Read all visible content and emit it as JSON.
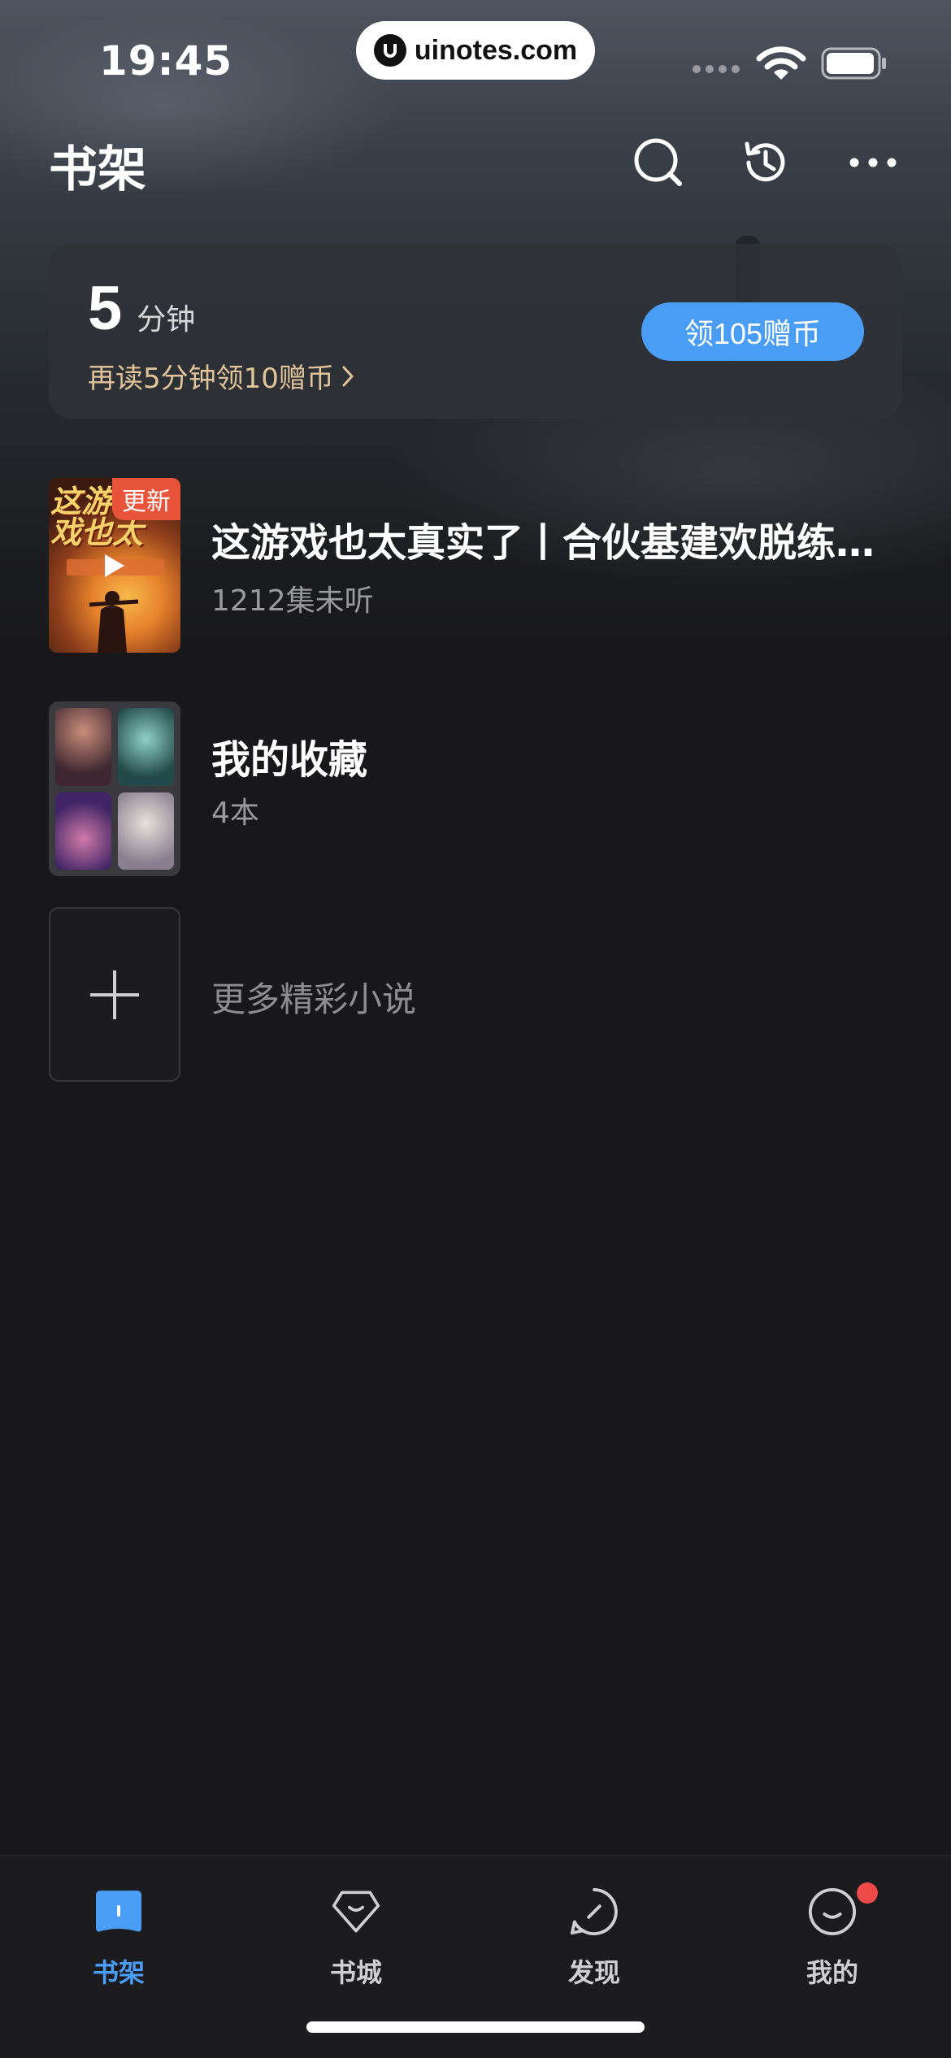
{
  "status_bar": {
    "time": "19:45",
    "url": "uinotes.com"
  },
  "header": {
    "title": "书架"
  },
  "reading_card": {
    "minutes_value": "5",
    "minutes_unit": "分钟",
    "reward_hint": "再读5分钟领10赠币",
    "claim_button": "领105赠币",
    "hint_color": "#e2c49a",
    "button_color": "#4a9df5"
  },
  "books": [
    {
      "cover_text": "这游戏也太真实了",
      "badge": "更新",
      "title": "这游戏也太真实了丨合伙基建欢脱练…",
      "subtitle": "1212集未听",
      "badge_color": "#e8543a"
    }
  ],
  "collection": {
    "title": "我的收藏",
    "count": "4本"
  },
  "add_more": {
    "label": "更多精彩小说"
  },
  "tab_bar": {
    "tabs": [
      {
        "label": "书架",
        "icon": "bookshelf-icon",
        "active": true
      },
      {
        "label": "书城",
        "icon": "bookstore-icon",
        "active": false
      },
      {
        "label": "发现",
        "icon": "compass-icon",
        "active": false
      },
      {
        "label": "我的",
        "icon": "profile-icon",
        "active": false,
        "notification_dot": true
      }
    ],
    "active_color": "#4a9df5",
    "dot_color": "#ee4a4a"
  }
}
